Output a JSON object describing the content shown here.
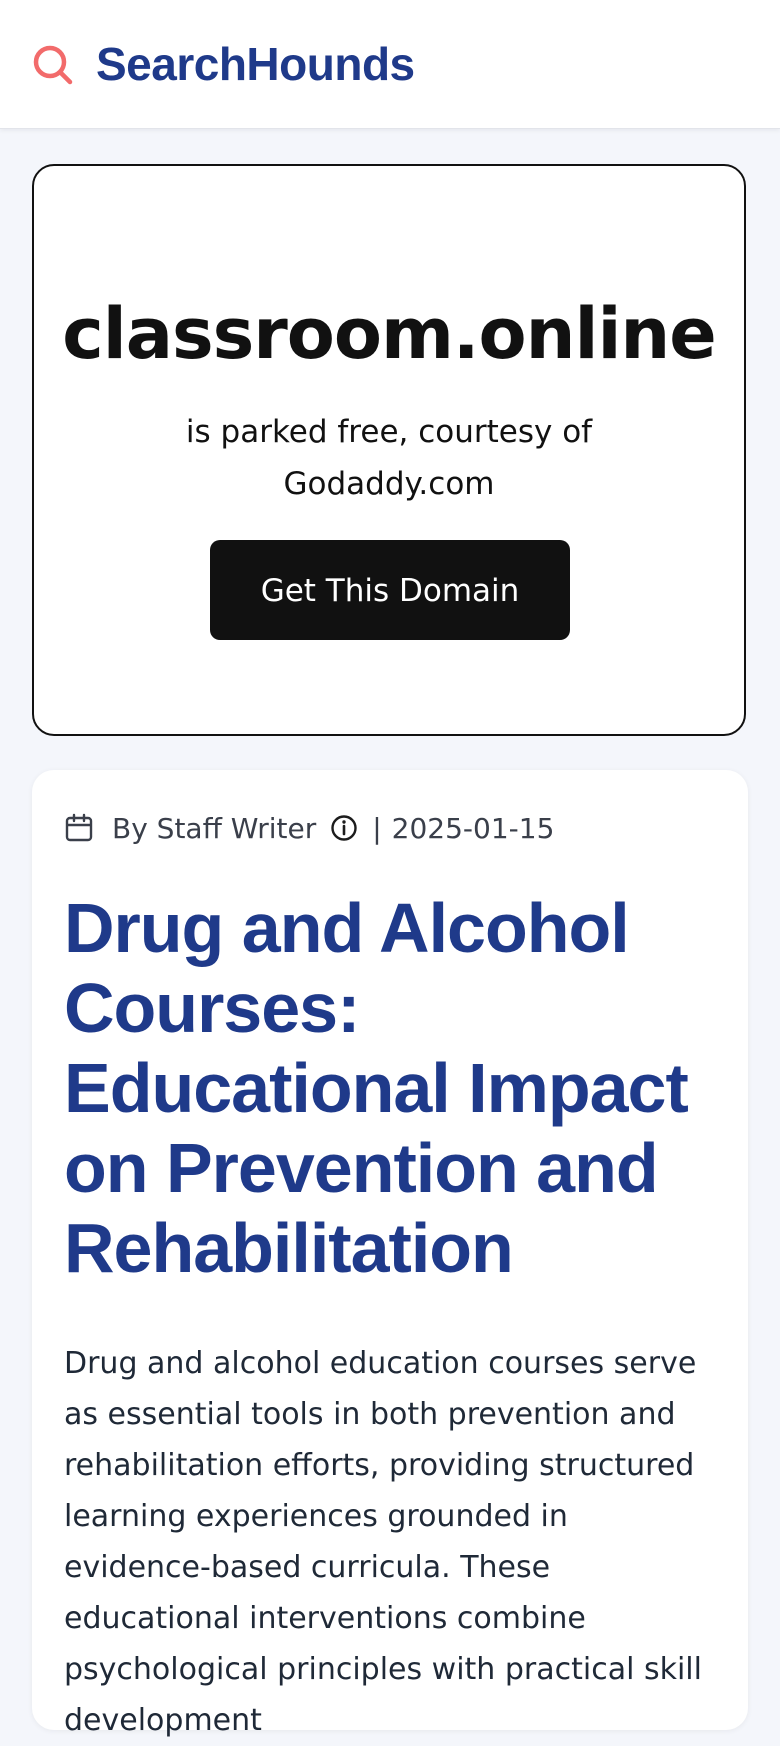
{
  "header": {
    "brand": "SearchHounds",
    "logo_icon": "search-icon",
    "accent_color": "#f26b6b",
    "brand_color": "#1f3a8a"
  },
  "parked": {
    "domain": "classroom.online",
    "message": "is parked free, courtesy of Godaddy.com",
    "cta_label": "Get This Domain"
  },
  "article": {
    "author": "By Staff Writer",
    "date_separator": "|",
    "date": "2025-01-15",
    "calendar_icon": "calendar-icon",
    "info_icon": "info-icon",
    "title": "Drug and Alcohol Courses: Educational Impact on Prevention and Rehabilitation",
    "body": "Drug and alcohol education courses serve as essential tools in both prevention and rehabilitation efforts, providing structured learning experiences grounded in evidence-based curricula. These educational interventions combine psychological principles with practical skill development"
  }
}
